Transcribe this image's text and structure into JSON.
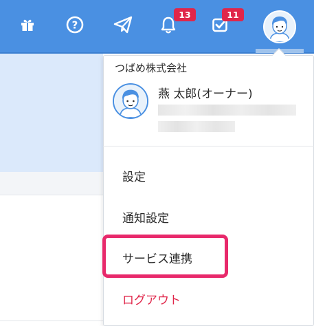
{
  "header": {
    "notifications_badge": "13",
    "tasks_badge": "11",
    "icons": [
      "gift-icon",
      "help-icon",
      "send-icon",
      "bell-icon",
      "task-check-icon"
    ],
    "brand_color": "#4a90e2",
    "badge_color": "#e0264a"
  },
  "user_menu": {
    "company": "つばめ株式会社",
    "user_name": "燕 太郎(オーナー)",
    "items": [
      {
        "label": "設定"
      },
      {
        "label": "通知設定"
      },
      {
        "label": "サービス連携",
        "highlighted": true
      },
      {
        "label": "ログアウト",
        "color": "#e0264a"
      }
    ],
    "highlight_color": "#e8296b"
  }
}
